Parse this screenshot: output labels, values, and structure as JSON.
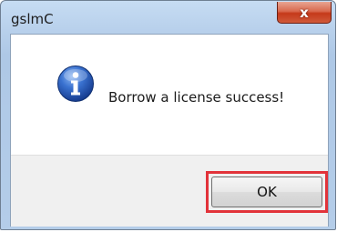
{
  "window": {
    "title": "gslmC",
    "close_label": "x"
  },
  "dialog": {
    "icon": "info-icon",
    "message": "Borrow a license success!",
    "ok_label": "OK"
  },
  "colors": {
    "title_bar": "#b9d1ec",
    "close_button": "#c5391a",
    "highlight_border": "#e2333a",
    "footer": "#f0f0f0",
    "info_icon": "#2456b5"
  }
}
